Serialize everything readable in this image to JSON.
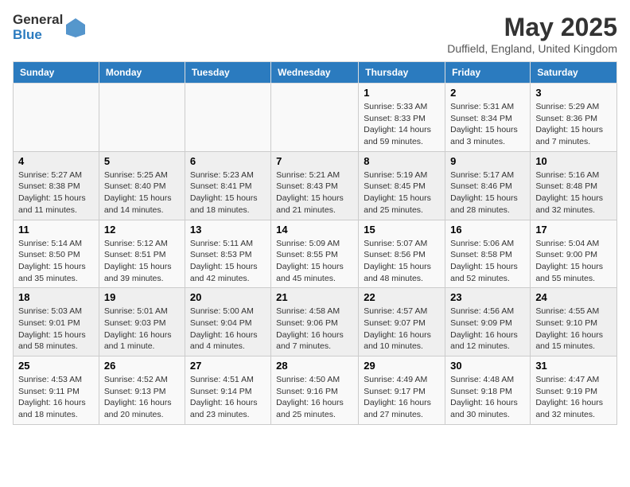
{
  "logo": {
    "general": "General",
    "blue": "Blue"
  },
  "header": {
    "month": "May 2025",
    "location": "Duffield, England, United Kingdom"
  },
  "days_of_week": [
    "Sunday",
    "Monday",
    "Tuesday",
    "Wednesday",
    "Thursday",
    "Friday",
    "Saturday"
  ],
  "weeks": [
    [
      {
        "day": "",
        "info": ""
      },
      {
        "day": "",
        "info": ""
      },
      {
        "day": "",
        "info": ""
      },
      {
        "day": "",
        "info": ""
      },
      {
        "day": "1",
        "info": "Sunrise: 5:33 AM\nSunset: 8:33 PM\nDaylight: 14 hours and 59 minutes."
      },
      {
        "day": "2",
        "info": "Sunrise: 5:31 AM\nSunset: 8:34 PM\nDaylight: 15 hours and 3 minutes."
      },
      {
        "day": "3",
        "info": "Sunrise: 5:29 AM\nSunset: 8:36 PM\nDaylight: 15 hours and 7 minutes."
      }
    ],
    [
      {
        "day": "4",
        "info": "Sunrise: 5:27 AM\nSunset: 8:38 PM\nDaylight: 15 hours and 11 minutes."
      },
      {
        "day": "5",
        "info": "Sunrise: 5:25 AM\nSunset: 8:40 PM\nDaylight: 15 hours and 14 minutes."
      },
      {
        "day": "6",
        "info": "Sunrise: 5:23 AM\nSunset: 8:41 PM\nDaylight: 15 hours and 18 minutes."
      },
      {
        "day": "7",
        "info": "Sunrise: 5:21 AM\nSunset: 8:43 PM\nDaylight: 15 hours and 21 minutes."
      },
      {
        "day": "8",
        "info": "Sunrise: 5:19 AM\nSunset: 8:45 PM\nDaylight: 15 hours and 25 minutes."
      },
      {
        "day": "9",
        "info": "Sunrise: 5:17 AM\nSunset: 8:46 PM\nDaylight: 15 hours and 28 minutes."
      },
      {
        "day": "10",
        "info": "Sunrise: 5:16 AM\nSunset: 8:48 PM\nDaylight: 15 hours and 32 minutes."
      }
    ],
    [
      {
        "day": "11",
        "info": "Sunrise: 5:14 AM\nSunset: 8:50 PM\nDaylight: 15 hours and 35 minutes."
      },
      {
        "day": "12",
        "info": "Sunrise: 5:12 AM\nSunset: 8:51 PM\nDaylight: 15 hours and 39 minutes."
      },
      {
        "day": "13",
        "info": "Sunrise: 5:11 AM\nSunset: 8:53 PM\nDaylight: 15 hours and 42 minutes."
      },
      {
        "day": "14",
        "info": "Sunrise: 5:09 AM\nSunset: 8:55 PM\nDaylight: 15 hours and 45 minutes."
      },
      {
        "day": "15",
        "info": "Sunrise: 5:07 AM\nSunset: 8:56 PM\nDaylight: 15 hours and 48 minutes."
      },
      {
        "day": "16",
        "info": "Sunrise: 5:06 AM\nSunset: 8:58 PM\nDaylight: 15 hours and 52 minutes."
      },
      {
        "day": "17",
        "info": "Sunrise: 5:04 AM\nSunset: 9:00 PM\nDaylight: 15 hours and 55 minutes."
      }
    ],
    [
      {
        "day": "18",
        "info": "Sunrise: 5:03 AM\nSunset: 9:01 PM\nDaylight: 15 hours and 58 minutes."
      },
      {
        "day": "19",
        "info": "Sunrise: 5:01 AM\nSunset: 9:03 PM\nDaylight: 16 hours and 1 minute."
      },
      {
        "day": "20",
        "info": "Sunrise: 5:00 AM\nSunset: 9:04 PM\nDaylight: 16 hours and 4 minutes."
      },
      {
        "day": "21",
        "info": "Sunrise: 4:58 AM\nSunset: 9:06 PM\nDaylight: 16 hours and 7 minutes."
      },
      {
        "day": "22",
        "info": "Sunrise: 4:57 AM\nSunset: 9:07 PM\nDaylight: 16 hours and 10 minutes."
      },
      {
        "day": "23",
        "info": "Sunrise: 4:56 AM\nSunset: 9:09 PM\nDaylight: 16 hours and 12 minutes."
      },
      {
        "day": "24",
        "info": "Sunrise: 4:55 AM\nSunset: 9:10 PM\nDaylight: 16 hours and 15 minutes."
      }
    ],
    [
      {
        "day": "25",
        "info": "Sunrise: 4:53 AM\nSunset: 9:11 PM\nDaylight: 16 hours and 18 minutes."
      },
      {
        "day": "26",
        "info": "Sunrise: 4:52 AM\nSunset: 9:13 PM\nDaylight: 16 hours and 20 minutes."
      },
      {
        "day": "27",
        "info": "Sunrise: 4:51 AM\nSunset: 9:14 PM\nDaylight: 16 hours and 23 minutes."
      },
      {
        "day": "28",
        "info": "Sunrise: 4:50 AM\nSunset: 9:16 PM\nDaylight: 16 hours and 25 minutes."
      },
      {
        "day": "29",
        "info": "Sunrise: 4:49 AM\nSunset: 9:17 PM\nDaylight: 16 hours and 27 minutes."
      },
      {
        "day": "30",
        "info": "Sunrise: 4:48 AM\nSunset: 9:18 PM\nDaylight: 16 hours and 30 minutes."
      },
      {
        "day": "31",
        "info": "Sunrise: 4:47 AM\nSunset: 9:19 PM\nDaylight: 16 hours and 32 minutes."
      }
    ]
  ]
}
